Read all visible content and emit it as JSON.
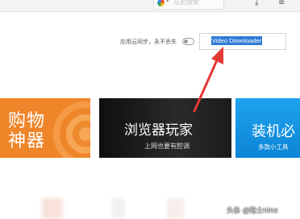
{
  "browser_bar": {
    "search_engine_label": "在此搜索",
    "icons": [
      "google-icon",
      "chevron-down-icon",
      "download-icon",
      "menu-icon"
    ]
  },
  "settings": {
    "sync_label": "应用云同步，永不丢失",
    "sync_enabled": false,
    "ua_input_value": "Video Downloader"
  },
  "cards": [
    {
      "title": "购物神器",
      "subtitle": ""
    },
    {
      "title": "浏览器玩家",
      "subtitle": "上网也要有腔调"
    },
    {
      "title": "装机必",
      "subtitle": "多款小工具"
    }
  ],
  "annotation": {
    "arrow_color": "#e53935"
  },
  "watermark": "头条 @隐士nine"
}
